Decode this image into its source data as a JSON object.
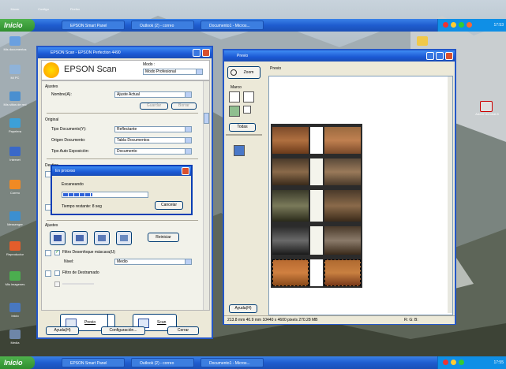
{
  "taskbar_top": {
    "start_label": "Inicio",
    "tasks": [
      "EPSON Smart Panel",
      "Outlook (2) - correo",
      "Documento1 - Micros..."
    ],
    "clock": "17:53"
  },
  "taskbar_bottom": {
    "start_label": "Inicio",
    "tasks": [
      "EPSON Smart Panel",
      "Outlook (2) - correo",
      "Documento1 - Micros..."
    ],
    "clock": "17:55"
  },
  "desktop": {
    "top_labels": [
      "Mover",
      "Configu",
      "Firefox"
    ],
    "left_labels": [
      "Mis documentos",
      "Mi PC",
      "Mis sitios de red",
      "Papelera",
      "Internet",
      "Correo",
      "Messenger",
      "Reproductor",
      "Mis imagenes",
      "Inicio",
      "Acrobat",
      "Word",
      "Excel",
      "Photoshop",
      "Media"
    ],
    "right_label": "Adobe Acrobat 8"
  },
  "epson": {
    "title": "EPSON Scan - EPSON Perfection 4490",
    "brand": "EPSON Scan",
    "mode_label": "Modo :",
    "mode_value": "Modo Profesional",
    "ajustes_header": "Ajustes",
    "nombre_label": "Nombre(A):",
    "nombre_value": "Ajuste Actual",
    "guardar": "Guardar",
    "borrar": "Borrar",
    "original_header": "Original",
    "tipo_doc_label": "Tipo Documento(Y):",
    "tipo_doc_value": "Reflectante",
    "origen_label": "Origen Documento:",
    "origen_value": "Tabla Documentos",
    "tipo_auto_label": "Tipo Auto Exposición:",
    "tipo_auto_value": "Documento",
    "destino_header": "Destino",
    "ajuste_header": "Ajustes",
    "reiniciar": "Reiniciar",
    "filtro_desenfoque": "Filtro Desenfoque máscara(U)",
    "nivel_label": "Nivel:",
    "nivel_value": "Medio",
    "filtro_destramado": "Filtro de Destramado",
    "previo": "Previo",
    "scan": "Scan",
    "ayuda": "Ayuda(H)",
    "configuracion": "Configuración...",
    "cerrar": "Cerrar"
  },
  "progress": {
    "title": "En proceso",
    "status": "Escaneando",
    "time": "Tiempo restante: 8 seg",
    "cancel": "Cancelar",
    "progress_fraction": 0.35
  },
  "preview": {
    "title": "Previo",
    "zoom": "Zoom",
    "tab": "Previo",
    "marco": "Marco",
    "todas": "Todas",
    "ayuda": "Ayuda(H)",
    "status": "213.8 mm  40.9 mm      10440 x 4600 pixels 270.28 MB",
    "status_right": "R: G: B:"
  }
}
